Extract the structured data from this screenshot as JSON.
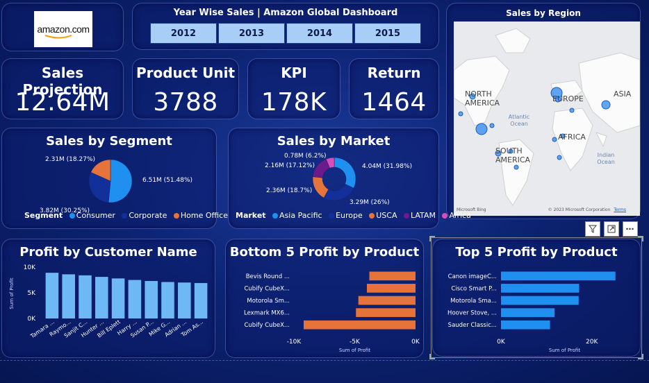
{
  "logo": {
    "text": "amazon.com"
  },
  "header": {
    "title": "Year Wise Sales | Amazon Global Dashboard",
    "years": [
      "2012",
      "2013",
      "2014",
      "2015"
    ]
  },
  "kpis": [
    {
      "title": "Sales Projection",
      "value": "12.64M"
    },
    {
      "title": "Product Unit",
      "value": "3788"
    },
    {
      "title": "KPI",
      "value": "178K"
    },
    {
      "title": "Return",
      "value": "1464"
    }
  ],
  "segment": {
    "title": "Sales by Segment",
    "legend_label": "Segment",
    "items": [
      "Consumer",
      "Corporate",
      "Home Office"
    ],
    "labels": [
      "6.51M (51.48%)",
      "3.82M (30.25%)",
      "2.31M (18.27%)"
    ],
    "colors": [
      "#1f8ff0",
      "#13309a",
      "#e5733a"
    ]
  },
  "market": {
    "title": "Sales by Market",
    "legend_label": "Market",
    "items": [
      "Asia Pacific",
      "Europe",
      "USCA",
      "LATAM",
      "Africa"
    ],
    "labels": [
      "4.04M (31.98%)",
      "3.29M (26%)",
      "2.36M (18.7%)",
      "2.16M (17.12%)",
      "0.78M (6.2%)"
    ],
    "colors": [
      "#1f8ff0",
      "#13309a",
      "#e5733a",
      "#6d1a8c",
      "#d64fb8"
    ]
  },
  "region_map": {
    "title": "Sales by Region",
    "places": [
      "NORTH AMERICA",
      "EUROPE",
      "ASIA",
      "AFRICA",
      "SOUTH AMERICA",
      "Atlantic Ocean",
      "Indian Ocean"
    ],
    "attribution": "© 2023 Microsoft Corporation",
    "terms": "Terms",
    "bing": "Microsoft Bing"
  },
  "visual_toolbar": {
    "filter_icon": "filter-icon",
    "focus_icon": "focus-mode-icon",
    "more_icon": "more-options-icon"
  },
  "chart_data": [
    {
      "type": "pie",
      "title": "Sales by Segment",
      "categories": [
        "Consumer",
        "Corporate",
        "Home Office"
      ],
      "values": [
        6.51,
        3.82,
        2.31
      ],
      "percent": [
        51.48,
        30.25,
        18.27
      ],
      "unit": "M"
    },
    {
      "type": "pie",
      "variant": "donut",
      "title": "Sales by Market",
      "categories": [
        "Asia Pacific",
        "Europe",
        "USCA",
        "LATAM",
        "Africa"
      ],
      "values": [
        4.04,
        3.29,
        2.36,
        2.16,
        0.78
      ],
      "percent": [
        31.98,
        26,
        18.7,
        17.12,
        6.2
      ],
      "unit": "M"
    },
    {
      "type": "bar",
      "title": "Profit by Customer Name",
      "categories": [
        "Tamara ...",
        "Raymo...",
        "Sanjit C...",
        "Hunter ...",
        "Bill Eplett",
        "Harry ...",
        "Susan P...",
        "Mike G...",
        "Adrian ...",
        "Tom As..."
      ],
      "values": [
        8900,
        8600,
        8400,
        8100,
        7800,
        7500,
        7300,
        7100,
        7000,
        6900
      ],
      "ylabel": "Sum of Profit",
      "ylim": [
        0,
        10000
      ],
      "yticks": [
        "0K",
        "5K",
        "10K"
      ],
      "color": "#6db8f5"
    },
    {
      "type": "bar",
      "orientation": "horizontal",
      "title": "Bottom 5 Profit by Product",
      "categories": [
        "Bevis Round ...",
        "Cubify CubeX...",
        "Motorola Sm...",
        "Lexmark MX6...",
        "Cubify CubeX..."
      ],
      "values": [
        -3800,
        -4000,
        -4700,
        -4900,
        -9200
      ],
      "xlabel": "Sum of Profit",
      "xlim": [
        -10000,
        0
      ],
      "xticks": [
        "-10K",
        "-5K",
        "0K"
      ],
      "color": "#e5733a"
    },
    {
      "type": "bar",
      "orientation": "horizontal",
      "title": "Top 5 Profit by Product",
      "categories": [
        "Canon imageC...",
        "Cisco Smart P...",
        "Motorola Sma...",
        "Hoover Stove, ...",
        "Sauder Classic..."
      ],
      "values": [
        25200,
        17200,
        17100,
        11800,
        10800
      ],
      "xlabel": "Sum of Profit",
      "xlim": [
        0,
        28000
      ],
      "xticks": [
        "0K",
        "20K"
      ],
      "color": "#1f8ff0"
    }
  ]
}
